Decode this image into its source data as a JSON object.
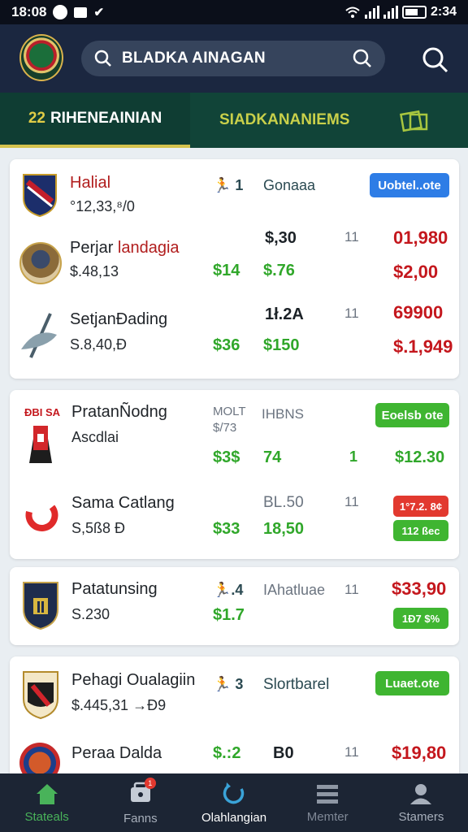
{
  "status_bar": {
    "time": "18:08",
    "right_time": "2:34",
    "sb_check": "✔"
  },
  "header": {
    "search_text": "BLADKA AINAGAN"
  },
  "tabs": [
    {
      "num": "22",
      "label": "RIHENEAINIAN"
    },
    {
      "label": "SIADKANANIEMS"
    }
  ],
  "cards": [
    {
      "pill": "Uobtel..ote",
      "rows": [
        {
          "name": "Halial",
          "sub": "°12,33,⁸/0",
          "col1": "🏃 1",
          "col2": "Gonaaa",
          "icon": "team-crest-icon"
        },
        {
          "name_a": "Perjar",
          "name_b": "landagia",
          "sub": "$.48,13",
          "a": "$14",
          "b": "$.76",
          "c": "$,30",
          "d": "11",
          "e": "01,980",
          "f": "$2,00",
          "icon": "player-avatar-icon"
        },
        {
          "name": "SetjanĐading",
          "sub": "S.8,40,Ð",
          "a": "$36",
          "b": "$150",
          "c": "1ł.2A",
          "d": "11",
          "e": "69900",
          "f": "$.1,949",
          "icon": "axe-logo-icon"
        }
      ]
    },
    {
      "pill": "Eoelsb ote",
      "rows": [
        {
          "name": "PratanÑodng",
          "sub": "Ascdlai",
          "top_small": "ĐBI SA",
          "col1a": "MOLT",
          "col1b": "$/73",
          "col2": "IHBNS",
          "a": "$3$",
          "b": "74",
          "c": "1",
          "e": "$12.30",
          "icon": "tower-crest-icon"
        },
        {
          "name": "Sama Catlang",
          "sub": "S,5ß8 Ð",
          "a": "$33",
          "b": "18,50",
          "c": "BL.50",
          "d": "11",
          "pill_red": "1°7.2. 8¢",
          "pill_green": "112 ßec",
          "icon": "red-logo-icon"
        }
      ]
    },
    {
      "rows": [
        {
          "name": "Patatunsing",
          "sub": "S.230",
          "a": "🏃.4",
          "b": "$1.7",
          "c": "IAhatluae",
          "d": "11",
          "e": "$33,90",
          "pill_green": "1Ð7 $%",
          "icon": "shield-crest-icon"
        }
      ]
    },
    {
      "pill": "Luaet.ote",
      "rows": [
        {
          "name": "Pehagi Oualagiin",
          "sub": "$.445,31 →Ð9",
          "col1": "🏃 3",
          "col2": "Slortbarel",
          "icon": "eagle-crest-icon"
        },
        {
          "name": "Peraa Dalda",
          "sub": "",
          "a": "$.:2",
          "b": "B0",
          "d": "11",
          "e": "$19,80",
          "icon": "round-crest-icon"
        }
      ]
    }
  ],
  "nav": [
    {
      "label": "Stateals",
      "icon": "home-icon"
    },
    {
      "label": "Fanns",
      "icon": "shop-icon",
      "badge": "1"
    },
    {
      "label": "Olahlangian",
      "icon": "refresh-icon"
    },
    {
      "label": "Memter",
      "icon": "menu-icon"
    },
    {
      "label": "Stamers",
      "icon": "profile-icon"
    }
  ],
  "colors": {
    "header": "#1b2740",
    "tabs": "#114438",
    "accent_green": "#30a72a",
    "accent_red": "#c4171d",
    "nav_bg": "#1c2534"
  }
}
